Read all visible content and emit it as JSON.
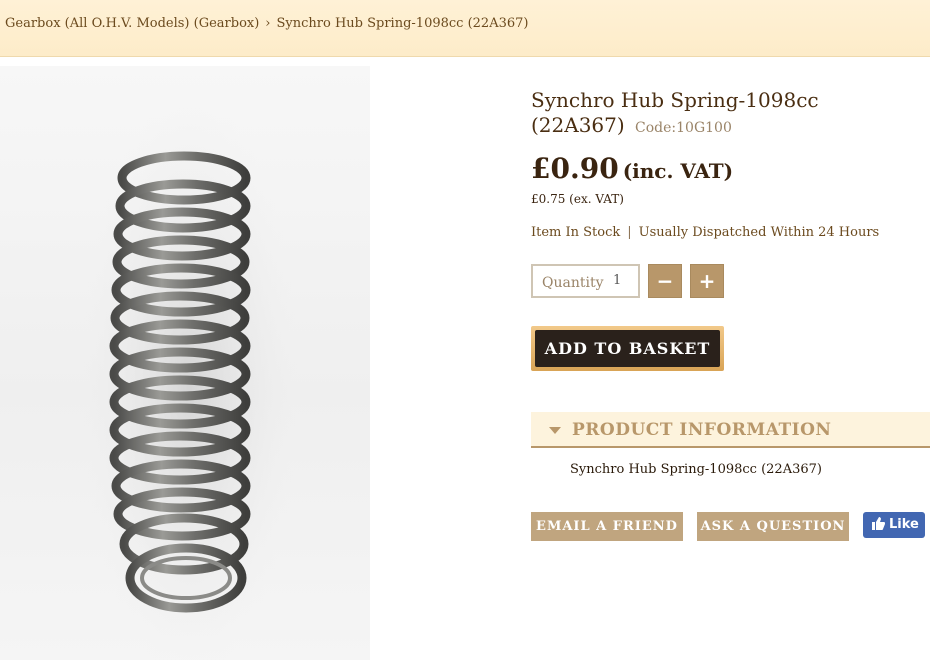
{
  "breadcrumb": {
    "items": [
      "Gearbox (All O.H.V. Models) (Gearbox)",
      "Synchro Hub Spring-1098cc (22A367)"
    ],
    "separator": "›"
  },
  "product": {
    "title": "Synchro Hub Spring-1098cc (22A367)",
    "code": "Code:10G100",
    "price_inc": "£0.90",
    "price_inc_suffix": "(inc. VAT)",
    "price_ex": "£0.75 (ex. VAT)",
    "stock": "Item In Stock",
    "dispatch": "Usually Dispatched Within 24 Hours",
    "stock_separator": "|",
    "image_icon": "coil-spring-image"
  },
  "quantity": {
    "label": "Quantity",
    "value": "1",
    "minus": "−",
    "plus": "+"
  },
  "add_to_basket": "ADD TO BASKET",
  "product_information": {
    "title": "PRODUCT INFORMATION",
    "body": "Synchro Hub Spring-1098cc (22A367)"
  },
  "actions": {
    "email_friend": "EMAIL A FRIEND",
    "ask_question": "ASK A QUESTION",
    "fb_like": "Like"
  },
  "colors": {
    "accent": "#b8976a",
    "breadcrumb_bg": "#fdecc9",
    "basket_bg": "#2a211b",
    "facebook": "#4267b2"
  }
}
